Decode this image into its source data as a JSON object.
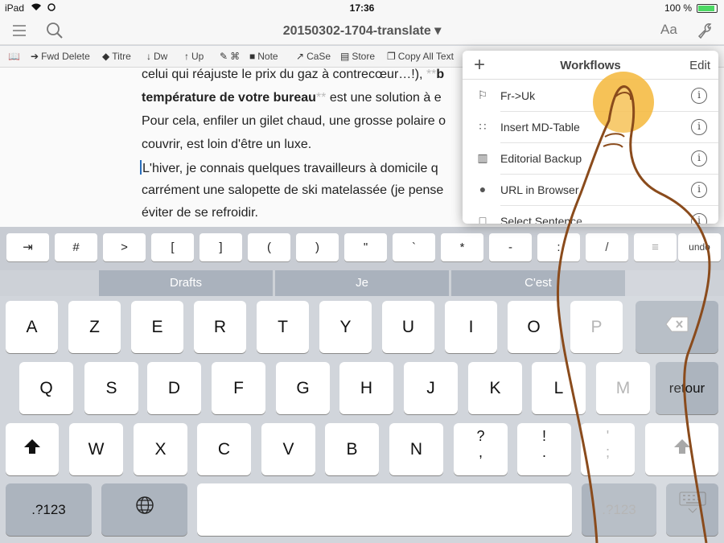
{
  "status": {
    "device": "iPad",
    "time": "17:36",
    "battery": "100 %"
  },
  "nav": {
    "title": "20150302-1704-translate ▾",
    "font_button": "Aa"
  },
  "toolbar": [
    {
      "icon": "book-icon",
      "glyph": "📖",
      "label": ""
    },
    {
      "icon": "forward-delete-icon",
      "glyph": "➔",
      "label": "Fwd Delete"
    },
    {
      "icon": "tag-icon",
      "glyph": "◆",
      "label": "Titre"
    },
    {
      "icon": "arrow-down-icon",
      "glyph": "↓",
      "label": "Dw"
    },
    {
      "icon": "arrow-up-icon",
      "glyph": "↑",
      "label": "Up"
    },
    {
      "icon": "edit-icon",
      "glyph": "✎",
      "label": "⌘"
    },
    {
      "icon": "note-icon",
      "glyph": "■",
      "label": "Note"
    },
    {
      "icon": "case-icon",
      "glyph": "↗",
      "label": "CaSe"
    },
    {
      "icon": "store-icon",
      "glyph": "▤",
      "label": "Store"
    },
    {
      "icon": "copy-icon",
      "glyph": "❐",
      "label": "Copy All Text"
    }
  ],
  "editor": {
    "l1a": "celui qui réajuste le prix du gaz à contrecœur…!),",
    "l1b": "**",
    "l1c": "b",
    "l2a": "température de votre bureau",
    "l2b": "**",
    "l2c": " est une solution à e",
    "l3": "Pour cela, enfiler un gilet chaud, une grosse polaire o",
    "l4": "couvrir, est loin d'être un luxe.",
    "l5": "L'hiver, je connais quelques travailleurs à domicile q",
    "l6": "carrément une salopette de ski matelassée (je pense",
    "l7": "éviter de se refroidir."
  },
  "workflows": {
    "title": "Workflows",
    "edit": "Edit",
    "add": "+",
    "items": [
      {
        "label": "Fr->Uk",
        "icon": "translate-icon",
        "glyph": "⚐"
      },
      {
        "label": "Insert MD-Table",
        "icon": "grid-icon",
        "glyph": "∷"
      },
      {
        "label": "Editorial Backup",
        "icon": "document-icon",
        "glyph": "▥"
      },
      {
        "label": "URL in Browser",
        "icon": "globe-icon",
        "glyph": "●"
      },
      {
        "label": "Select Sentence",
        "icon": "select-icon",
        "glyph": "□"
      }
    ],
    "info": "i"
  },
  "extra_keys": [
    "⇥",
    "#",
    ">",
    "[",
    "]",
    "(",
    ")",
    "\"",
    "`",
    "*",
    "-",
    ":",
    "/",
    "≡",
    "undo"
  ],
  "suggestions": [
    "Drafts",
    "Je",
    "C'est"
  ],
  "keyboard": {
    "row1": [
      "A",
      "Z",
      "E",
      "R",
      "T",
      "Y",
      "U",
      "I",
      "O",
      "P"
    ],
    "row2": [
      "Q",
      "S",
      "D",
      "F",
      "G",
      "H",
      "J",
      "K",
      "L",
      "M"
    ],
    "return": "retour",
    "row3": [
      "W",
      "X",
      "C",
      "V",
      "B",
      "N"
    ],
    "row3b": [
      {
        "top": "?",
        "bot": ","
      },
      {
        "top": "!",
        "bot": "."
      },
      {
        "top": "'",
        "bot": ";"
      }
    ],
    "num_left": ".?123",
    "num_right": ".?123",
    "globe": "🌐"
  }
}
